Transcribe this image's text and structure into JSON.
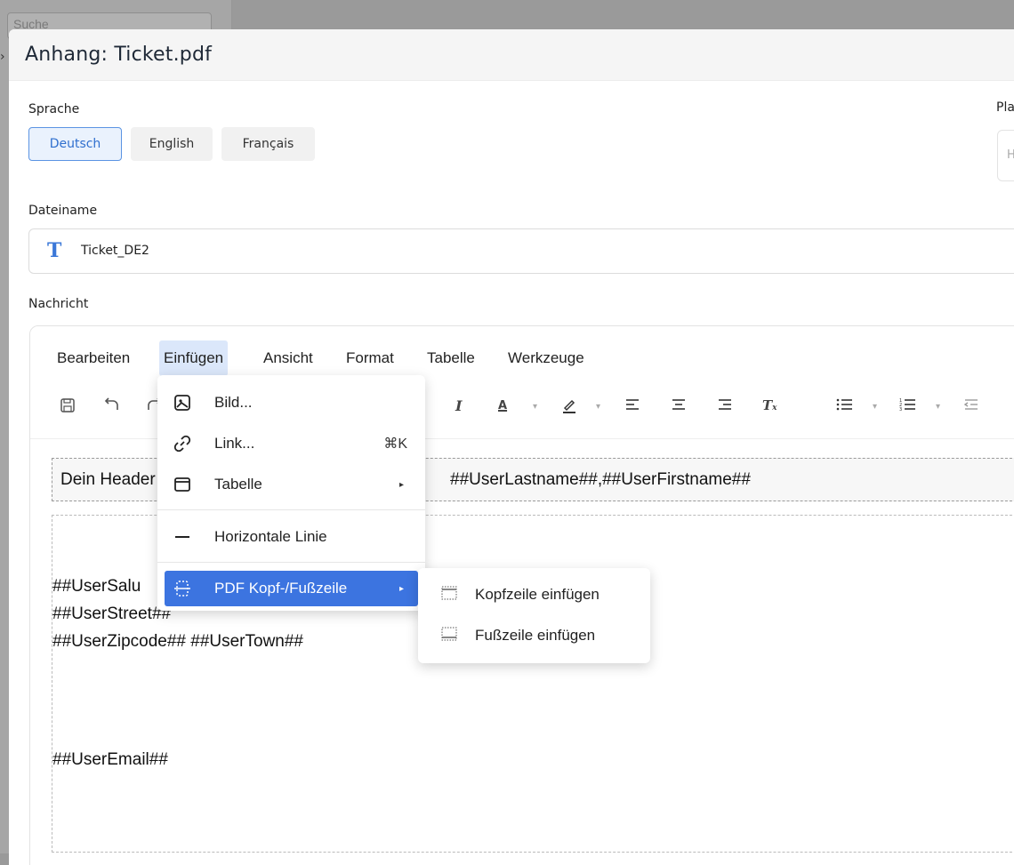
{
  "background": {
    "search_placeholder": "Suche",
    "collapse_glyph": "›"
  },
  "modal": {
    "title": "Anhang: Ticket.pdf"
  },
  "language": {
    "label": "Sprache",
    "options": [
      "Deutsch",
      "English",
      "Français"
    ],
    "selected": "Deutsch"
  },
  "placeholder_field": {
    "label_partial": "Pla",
    "value_partial": "H"
  },
  "filename": {
    "label": "Dateiname",
    "value": "Ticket_DE2",
    "icon": "text-type-icon"
  },
  "message": {
    "label": "Nachricht"
  },
  "editor": {
    "menus": [
      "Bearbeiten",
      "Einfügen",
      "Ansicht",
      "Format",
      "Tabelle",
      "Werkzeuge"
    ],
    "open_menu": "Einfügen",
    "toolbar_icons": [
      "save-icon",
      "undo-icon",
      "redo-icon",
      "italic-icon",
      "font-color-icon",
      "highlight-icon",
      "align-left-icon",
      "align-center-icon",
      "align-right-icon",
      "clear-format-icon",
      "bullet-list-icon",
      "numbered-list-icon",
      "outdent-icon"
    ],
    "content": {
      "header_left": "Dein Header",
      "header_right": "##UserLastname##,##UserFirstname##",
      "lines": [
        "##UserSalu",
        "##UserStreet##",
        "##UserZipcode## ##UserTown##",
        "##UserEmail##"
      ]
    }
  },
  "insert_menu": {
    "items": [
      {
        "label": "Bild...",
        "icon": "image-icon"
      },
      {
        "label": "Link...",
        "icon": "link-icon",
        "shortcut": "⌘K"
      },
      {
        "label": "Tabelle",
        "icon": "table-icon"
      },
      {
        "label": "Horizontale Linie",
        "icon": "horizontal-line-icon"
      },
      {
        "label": "PDF Kopf-/Fußzeile",
        "icon": "pdf-header-footer-icon"
      }
    ]
  },
  "pdf_submenu": {
    "items": [
      {
        "label": "Kopfzeile einfügen",
        "icon": "header-icon"
      },
      {
        "label": "Fußzeile einfügen",
        "icon": "footer-icon"
      }
    ]
  },
  "colors": {
    "accent": "#3c74e0",
    "menu_open_bg": "#dbe7fa",
    "selected_lang_bg": "#eaf2fd"
  }
}
